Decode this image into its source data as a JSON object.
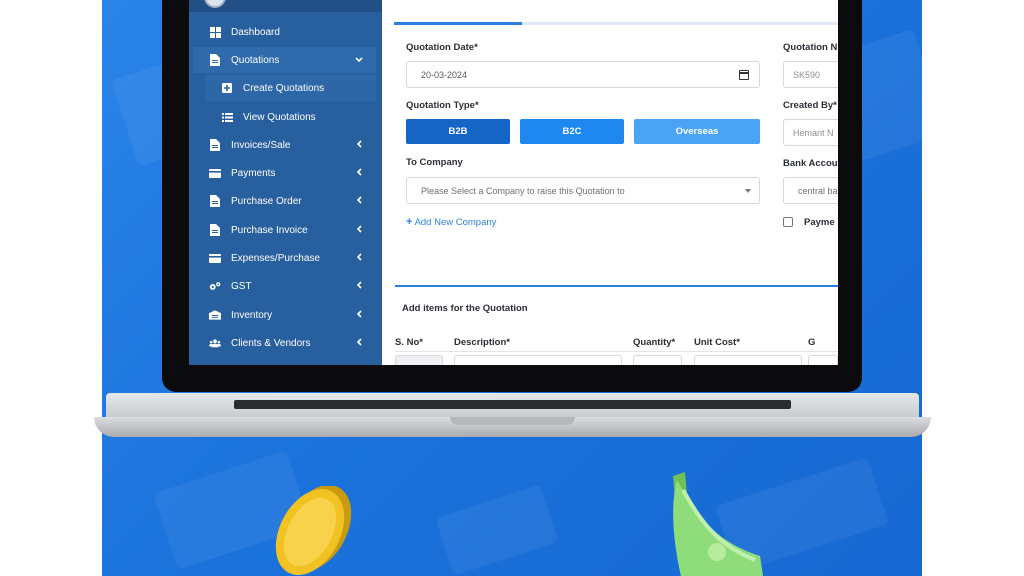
{
  "sidebar": {
    "items": [
      {
        "label": "Dashboard",
        "icon": "grid-icon"
      },
      {
        "label": "Quotations",
        "icon": "document-icon",
        "chevron": "down"
      },
      {
        "label": "Invoices/Sale",
        "icon": "document-icon",
        "chevron": "left"
      },
      {
        "label": "Payments",
        "icon": "card-icon",
        "chevron": "left"
      },
      {
        "label": "Purchase Order",
        "icon": "document-icon",
        "chevron": "left"
      },
      {
        "label": "Purchase Invoice",
        "icon": "document-icon",
        "chevron": "left"
      },
      {
        "label": "Expenses/Purchase",
        "icon": "card-icon",
        "chevron": "left"
      },
      {
        "label": "GST",
        "icon": "cogs-icon",
        "chevron": "left"
      },
      {
        "label": "Inventory",
        "icon": "warehouse-icon",
        "chevron": "left"
      },
      {
        "label": "Clients & Vendors",
        "icon": "users-icon",
        "chevron": "left"
      }
    ],
    "subitems": [
      {
        "label": "Create Quotations",
        "icon": "plus-square-icon"
      },
      {
        "label": "View Quotations",
        "icon": "list-icon"
      }
    ]
  },
  "form": {
    "quotation_date_label": "Quotation Date*",
    "quotation_date_value": "20-03-2024",
    "quotation_number_label": "Quotation N",
    "quotation_number_value": "SK590",
    "quotation_type_label": "Quotation Type*",
    "types": [
      "B2B",
      "B2C",
      "Overseas"
    ],
    "selected_type": "B2B",
    "created_by_label": "Created By*",
    "created_by_value": "Hemant N",
    "to_company_label": "To Company",
    "to_company_placeholder": "Please Select a Company to raise this Quotation to",
    "bank_account_label": "Bank Accou",
    "bank_account_value": "central ba",
    "add_company_link": "Add New Company",
    "payment_label": "Payme"
  },
  "items_table": {
    "title": "Add items for the Quotation",
    "headers": [
      "S. No*",
      "Description*",
      "Quantity*",
      "Unit Cost*",
      "G"
    ]
  },
  "colors": {
    "sidebar": "#285f9f",
    "accent": "#2a7de1",
    "type_b2b": "#1565c7",
    "type_b2c": "#1e88f0",
    "type_overseas": "#4aa3f5",
    "background": "#1b73dc"
  }
}
